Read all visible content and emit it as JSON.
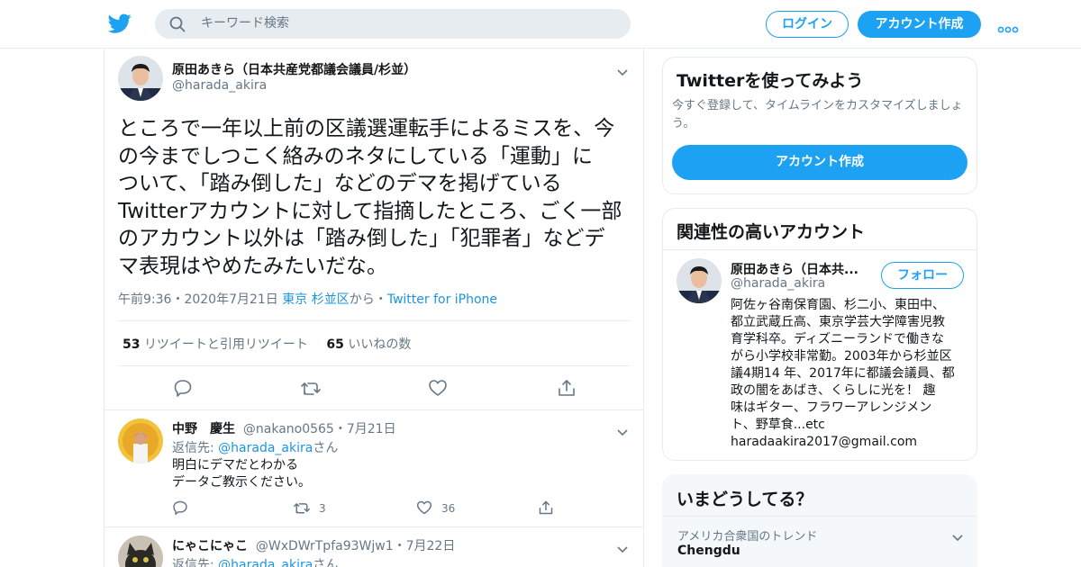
{
  "colors": {
    "accent": "#1da1f2",
    "link": "#1b95e0",
    "text": "#14171a",
    "muted": "#657786",
    "border": "#e6ecf0",
    "like_pink": "#e0245e",
    "retweet_green": "#17bf63"
  },
  "header": {
    "logo_icon": "twitter-bird-icon",
    "search_placeholder": "キーワード検索",
    "login_label": "ログイン",
    "signup_label": "アカウント作成",
    "more_icon": "more-dots-icon"
  },
  "tweet": {
    "author_name": "原田あきら（日本共産党都議会議員/杉並）",
    "author_handle": "@harada_akira",
    "text": "ところで一年以上前の区議選運転手によるミスを、今\nの今までしつこく絡みのネタにしている「運動」に\nついて、「踏み倒した」などのデマを掲げている\nTwitterアカウントに対して指摘したところ、ごく一部\nのアカウント以外は「踏み倒した」「犯罪者」などデ\nマ表現はやめたみたいだな。",
    "time": "午前9:36",
    "date": "2020年7月21日",
    "location": "東京 杉並区",
    "location_suffix": "から",
    "source": "Twitter for iPhone",
    "sep": "・",
    "retweets": "53",
    "retweets_label": "リツイートと引用リツイート",
    "likes": "65",
    "likes_label": "いいねの数"
  },
  "replies": [
    {
      "name": "中野　慶生",
      "handle": "@nakano0565",
      "date": "7月21日",
      "reply_prefix": "返信先: ",
      "reply_to": "@harada_akira",
      "reply_suffix": "さん",
      "text": "明白にデマだとわかる\nデータご教示ください。",
      "retweets": "3",
      "likes": "36"
    },
    {
      "name": "にゃこにゃこ",
      "handle": "@WxDWrTpfa93Wjw1",
      "date": "7月22日",
      "reply_prefix": "返信先: ",
      "reply_to": "@harada_akira",
      "reply_suffix": "さん"
    }
  ],
  "sidebar": {
    "try_card": {
      "title": "Twitterを使ってみよう",
      "subtitle": "今すぐ登録して、タイムラインをカスタマイズしましょう。",
      "button": "アカウント作成"
    },
    "related_card": {
      "title": "関連性の高いアカウント",
      "name": "原田あきら（日本共...",
      "handle": "@harada_akira",
      "follow": "フォロー",
      "bio": "阿佐ヶ谷南保育園、杉二小、東田中、\n都立武蔵丘高、東京学芸大学障害児教\n育学科卒。ディズニーランドで働きな\nがら小学校非常勤。2003年から杉並区\n議4期14 年、2017年に都議会議員、都\n政の闇をあばき、くらしに光を！ 趣\n味はギター、フラワーアレンジメン\nト、野草食...etc\nharadaakira2017@gmail.com"
    },
    "trends_card": {
      "title": "いまどうしてる？",
      "trend_context": "アメリカ合衆国のトレンド",
      "trend_name": "Chengdu"
    }
  }
}
